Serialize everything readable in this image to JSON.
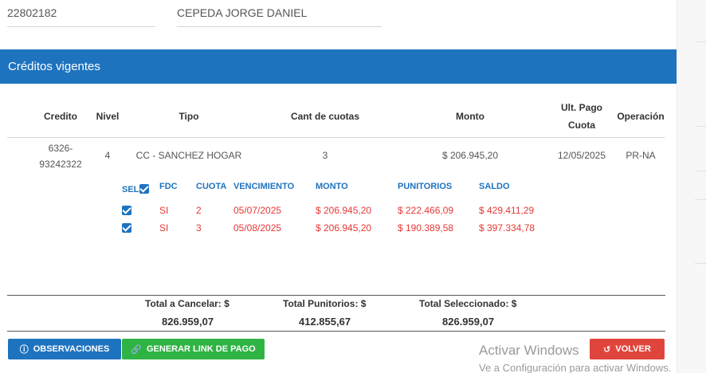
{
  "client": {
    "document": "22802182",
    "name": "CEPEDA JORGE DANIEL"
  },
  "panel": {
    "title": "Créditos vigentes"
  },
  "table": {
    "headers": {
      "credito": "Credito",
      "nivel": "Nivel",
      "tipo": "Tipo",
      "cant_cuotas": "Cant de cuotas",
      "monto": "Monto",
      "ult_pago_1": "Ult. Pago",
      "ult_pago_2": "Cuota",
      "operacion": "Operación"
    },
    "row": {
      "credito_1": "6326-",
      "credito_2": "93242322",
      "nivel": "4",
      "tipo": "CC - SANCHEZ HOGAR",
      "cant_cuotas": "3",
      "monto": "$ 206.945,20",
      "ult_pago": "12/05/2025",
      "operacion": "PR-NA"
    }
  },
  "installments": {
    "headers": {
      "sel": "SEL",
      "fdc": "FDC",
      "cuota": "CUOTA",
      "vencimiento": "VENCIMIENTO",
      "monto": "MONTO",
      "punitorios": "PUNITORIOS",
      "saldo": "SALDO"
    },
    "rows": [
      {
        "fdc": "SI",
        "cuota": "2",
        "vencimiento": "05/07/2025",
        "monto": "$ 206.945,20",
        "punitorios": "$ 222.466,09",
        "saldo": "$ 429.411,29"
      },
      {
        "fdc": "SI",
        "cuota": "3",
        "vencimiento": "05/08/2025",
        "monto": "$ 206.945,20",
        "punitorios": "$ 190.389,58",
        "saldo": "$ 397.334,78"
      }
    ]
  },
  "totals": {
    "cancelar_label": "Total a Cancelar: $",
    "cancelar_value": "826.959,07",
    "punitorios_label": "Total Punitorios: $",
    "punitorios_value": "412.855,67",
    "seleccionado_label": "Total Seleccionado: $",
    "seleccionado_value": "826.959,07"
  },
  "buttons": {
    "observaciones": "OBSERVACIONES",
    "generar_link": "GENERAR LINK DE PAGO",
    "volver": "VOLVER"
  },
  "watermark": {
    "line1": "Activar Windows",
    "line2": "Ve a Configuración para activar Windows."
  },
  "colors": {
    "primary": "#1e73be",
    "success": "#2fb344",
    "danger": "#e0453d",
    "installment_text": "#e53935"
  },
  "icons": {
    "observaciones": "info-icon",
    "generar_link": "link-icon",
    "volver": "undo-icon",
    "sel_all": "checkbox-checked-icon"
  }
}
